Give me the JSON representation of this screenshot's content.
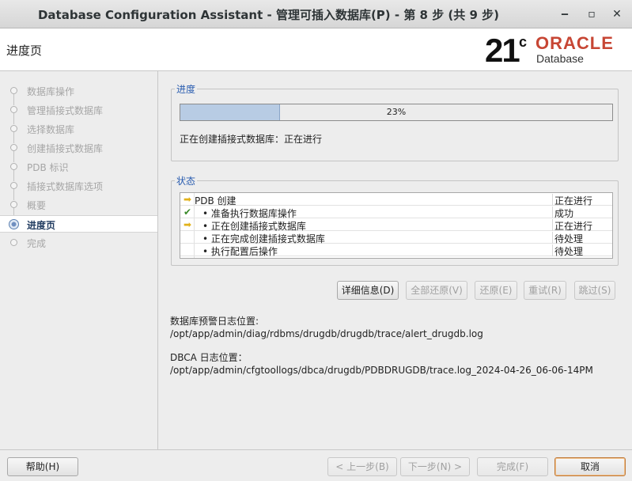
{
  "window": {
    "title": "Database Configuration Assistant - 管理可插入数据库(P) - 第 8 步 (共 9 步)",
    "minimize": "‒",
    "maximize": "▫",
    "close": "✕"
  },
  "header": {
    "page_title": "进度页",
    "logo_version": "21",
    "logo_suffix": "c",
    "logo_brand": "ORACLE",
    "logo_product": "Database"
  },
  "sidebar": {
    "steps": [
      {
        "label": "数据库操作",
        "state": "done"
      },
      {
        "label": "管理插接式数据库",
        "state": "done"
      },
      {
        "label": "选择数据库",
        "state": "done"
      },
      {
        "label": "创建插接式数据库",
        "state": "done"
      },
      {
        "label": "PDB 标识",
        "state": "done"
      },
      {
        "label": "插接式数据库选项",
        "state": "done"
      },
      {
        "label": "概要",
        "state": "done"
      },
      {
        "label": "进度页",
        "state": "active"
      },
      {
        "label": "完成",
        "state": "pending"
      }
    ]
  },
  "progress": {
    "legend": "进度",
    "percent": 23,
    "percent_label": "23%",
    "status_text": "正在创建插接式数据库：正在进行"
  },
  "status": {
    "legend": "状态",
    "rows": [
      {
        "icon": "arrow-right-icon",
        "name": "PDB 创建",
        "state": "正在进行",
        "level": 0
      },
      {
        "icon": "checkmark-icon",
        "name": "准备执行数据库操作",
        "state": "成功",
        "level": 1
      },
      {
        "icon": "arrow-right-icon",
        "name": "正在创建插接式数据库",
        "state": "正在进行",
        "level": 1
      },
      {
        "icon": "",
        "name": "正在完成创建插接式数据库",
        "state": "待处理",
        "level": 1
      },
      {
        "icon": "",
        "name": "执行配置后操作",
        "state": "待处理",
        "level": 1
      }
    ]
  },
  "actions": {
    "details": "详细信息(D)",
    "revert_all": "全部还原(V)",
    "revert": "还原(E)",
    "retry": "重试(R)",
    "skip": "跳过(S)"
  },
  "logs": {
    "alert_label": "数据库预警日志位置:",
    "alert_path": "/opt/app/admin/diag/rdbms/drugdb/drugdb/trace/alert_drugdb.log",
    "dbca_label": "DBCA 日志位置：",
    "dbca_path": "/opt/app/admin/cfgtoollogs/dbca/drugdb/PDBDRUGDB/trace.log_2024-04-26_06-06-14PM"
  },
  "footer": {
    "help": "帮助(H)",
    "back": "< 上一步(B)",
    "next": "下一步(N) >",
    "finish": "完成(F)",
    "cancel": "取消"
  },
  "colors": {
    "accent": "#2a5db0",
    "progress_fill": "#b8cce4",
    "oracle_red": "#c74634",
    "success_green": "#3a8a2a",
    "arrow_yellow": "#e2b21b"
  }
}
